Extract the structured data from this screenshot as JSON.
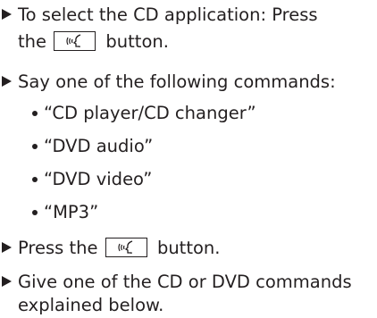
{
  "steps": [
    {
      "line1": "To select the CD application: Press",
      "before_key": "the",
      "after_key": "button.",
      "key_icon": "voice-control-icon"
    },
    {
      "line1": "Say one of the following commands:"
    },
    {
      "line1_before": "Press the",
      "line1_after": "button.",
      "key_icon": "voice-control-icon"
    },
    {
      "line1": "Give one of the CD or DVD commands",
      "line2": "explained below."
    }
  ],
  "commands": [
    "“CD player/CD changer”",
    "“DVD audio”",
    "“DVD video”",
    "“MP3”"
  ]
}
